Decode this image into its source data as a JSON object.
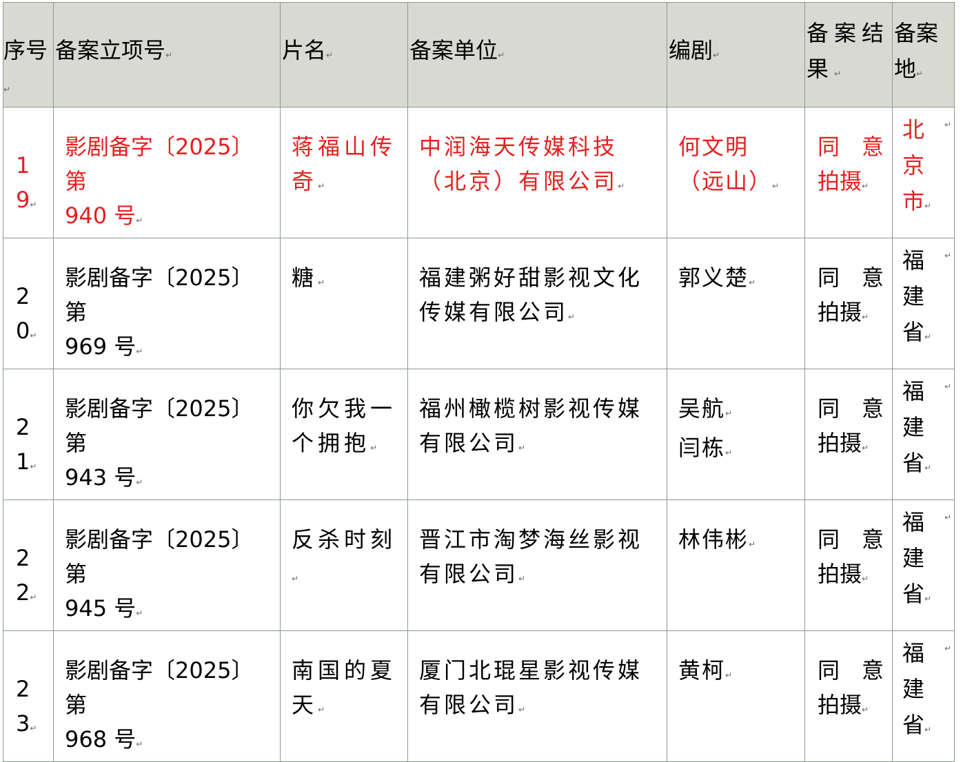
{
  "columns": [
    "序号",
    "备案立项号",
    "片名",
    "备案单位",
    "编剧",
    "备案结果",
    "备案地"
  ],
  "para_mark": "↵",
  "rows": [
    {
      "idx": "19",
      "filing_no_a": "影剧备字〔2025〕第",
      "filing_no_b": "940 号",
      "title": "蒋福山传奇",
      "company": "中润海天传媒科技（北京）有限公司",
      "writers": [
        "何文明（远山）"
      ],
      "result_a": "同意",
      "result_b": "拍摄",
      "location": [
        "北",
        "京",
        "市"
      ],
      "highlight": true
    },
    {
      "idx": "20",
      "filing_no_a": "影剧备字〔2025〕第",
      "filing_no_b": "969 号",
      "title": "糖",
      "company": "福建粥好甜影视文化传媒有限公司",
      "writers": [
        "郭义楚"
      ],
      "result_a": "同意",
      "result_b": "拍摄",
      "location": [
        "福",
        "建",
        "省"
      ],
      "highlight": false
    },
    {
      "idx": "21",
      "filing_no_a": "影剧备字〔2025〕第",
      "filing_no_b": "943 号",
      "title": "你欠我一个拥抱",
      "company": "福州橄榄树影视传媒有限公司",
      "writers": [
        "吴航",
        "闫栋"
      ],
      "result_a": "同意",
      "result_b": "拍摄",
      "location": [
        "福",
        "建",
        "省"
      ],
      "highlight": false
    },
    {
      "idx": "22",
      "filing_no_a": "影剧备字〔2025〕第",
      "filing_no_b": "945 号",
      "title": "反杀时刻",
      "company": "晋江市淘梦海丝影视有限公司",
      "writers": [
        "林伟彬"
      ],
      "result_a": "同意",
      "result_b": "拍摄",
      "location": [
        "福",
        "建",
        "省"
      ],
      "highlight": false
    },
    {
      "idx": "23",
      "filing_no_a": "影剧备字〔2025〕第",
      "filing_no_b": "968 号",
      "title": "南国的夏天",
      "company": "厦门北琨星影视传媒有限公司",
      "writers": [
        "黄柯"
      ],
      "result_a": "同意",
      "result_b": "拍摄",
      "location": [
        "福",
        "建",
        "省"
      ],
      "highlight": false
    }
  ]
}
